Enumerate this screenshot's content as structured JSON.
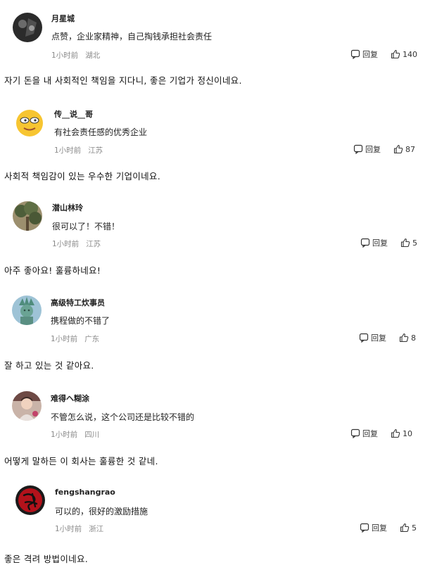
{
  "comments": [
    {
      "username": "月星城",
      "text": "点赞，企业家精神，自己掏钱承担社会责任",
      "time": "1小时前",
      "location": "湖北",
      "reply_label": "回复",
      "likes": "140",
      "translation": "자기 돈을 내 사회적인 책임을 지다니, 좋은 기업가 정신이네요.",
      "avatar_icon": "avatar-dark-figure-icon"
    },
    {
      "username": "传__说__哥",
      "text": "有社会责任感的优秀企业",
      "time": "1小时前",
      "location": "江苏",
      "reply_label": "回复",
      "likes": "87",
      "translation": "사회적 책임감이 있는 우수한 기업이네요.",
      "avatar_icon": "avatar-emoji-face-icon"
    },
    {
      "username": "潜山林玲",
      "text": "很可以了！不错！",
      "time": "1小时前",
      "location": "江苏",
      "reply_label": "回复",
      "likes": "5",
      "translation": "아주 좋아요! 훌륭하네요!",
      "avatar_icon": "avatar-tree-icon"
    },
    {
      "username": "高级特工炊事员",
      "text": "携程做的不错了",
      "time": "1小时前",
      "location": "广东",
      "reply_label": "回复",
      "likes": "8",
      "translation": "잘 하고 있는 것 같아요.",
      "avatar_icon": "avatar-statue-icon"
    },
    {
      "username": "难得ヘ糊涂",
      "text": "不管怎么说，这个公司还是比较不错的",
      "time": "1小时前",
      "location": "四川",
      "reply_label": "回复",
      "likes": "10",
      "translation": "어떻게 말하든 이 회사는 훌륭한 것 같네.",
      "avatar_icon": "avatar-child-photo-icon"
    },
    {
      "username": "fengshangrao",
      "text": "可以的，很好的激励措施",
      "time": "1小时前",
      "location": "浙江",
      "reply_label": "回复",
      "likes": "5",
      "translation": "좋은 격려 방법이네요.",
      "avatar_icon": "avatar-red-calligraphy-icon"
    }
  ],
  "colors": {
    "meta_gray": "#8a8a8a",
    "text": "#222222"
  }
}
